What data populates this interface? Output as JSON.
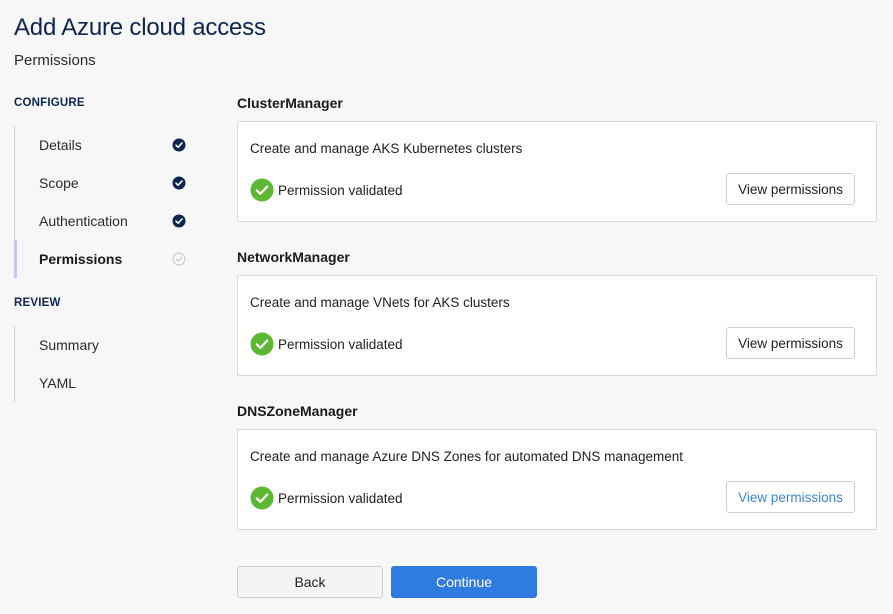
{
  "header": {
    "title": "Add Azure cloud access",
    "subtitle": "Permissions"
  },
  "sidebar": {
    "configure_label": "CONFIGURE",
    "configure_items": [
      {
        "label": "Details",
        "status": "complete",
        "icon": "check-filled-icon"
      },
      {
        "label": "Scope",
        "status": "complete",
        "icon": "check-filled-icon"
      },
      {
        "label": "Authentication",
        "status": "complete",
        "icon": "check-filled-icon"
      },
      {
        "label": "Permissions",
        "status": "current",
        "icon": "check-outline-icon"
      }
    ],
    "review_label": "REVIEW",
    "review_items": [
      {
        "label": "Summary"
      },
      {
        "label": "YAML"
      }
    ]
  },
  "permissions": [
    {
      "title": "ClusterManager",
      "description": "Create and manage AKS Kubernetes clusters",
      "status": "Permission validated",
      "button": "View permissions"
    },
    {
      "title": "NetworkManager",
      "description": "Create and manage VNets for AKS clusters",
      "status": "Permission validated",
      "button": "View permissions"
    },
    {
      "title": "DNSZoneManager",
      "description": "Create and manage Azure DNS Zones for automated DNS management",
      "status": "Permission validated",
      "button": "View permissions"
    }
  ],
  "footer": {
    "back_label": "Back",
    "continue_label": "Continue"
  },
  "colors": {
    "title": "#0d2650",
    "primary": "#2f7be0",
    "success": "#5cb833",
    "step_complete": "#0d2650",
    "link": "#3a86d6"
  }
}
